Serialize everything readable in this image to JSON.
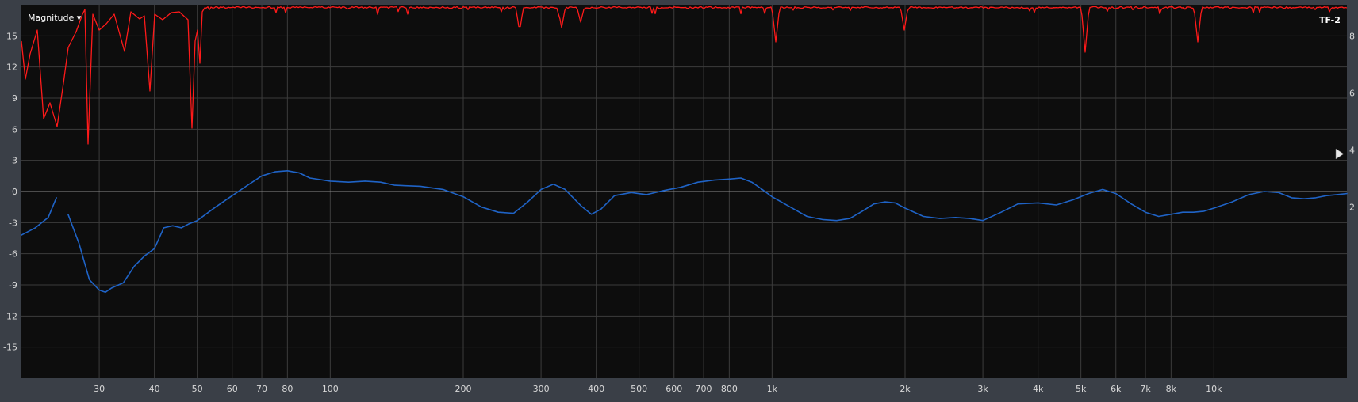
{
  "header": {
    "view_selector": "Magnitude ▾",
    "trace_label": "TF-2"
  },
  "colors": {
    "background": "#0d0d0d",
    "frame": "#3a3f47",
    "grid": "#3c3c3c",
    "zero_line": "#8a8a8a",
    "magnitude_trace": "#1f63c6",
    "coherence_trace": "#ff1a1a"
  },
  "icons": {
    "reference_marker": "triangle-marker-icon"
  },
  "chart_data": {
    "type": "line",
    "x_scale": "log",
    "xlim": [
      20,
      20000
    ],
    "ylim": [
      -18,
      18
    ],
    "grid": true,
    "y_ticks": [
      15,
      12,
      9,
      6,
      3,
      0,
      -3,
      -6,
      -9,
      -12,
      -15
    ],
    "y_tick_labels": [
      "15",
      "12",
      "9",
      "6",
      "3",
      "0",
      "-3",
      "-6",
      "-9",
      "-12",
      "-15"
    ],
    "right_ticks": [
      {
        "label": "8",
        "at": 15
      },
      {
        "label": "6",
        "at": 9.5
      },
      {
        "label": "4",
        "at": 4
      },
      {
        "label": "2",
        "at": -1.5
      }
    ],
    "x_ticks": [
      {
        "value": 30,
        "label": "30"
      },
      {
        "value": 40,
        "label": "40"
      },
      {
        "value": 50,
        "label": "50"
      },
      {
        "value": 60,
        "label": "60"
      },
      {
        "value": 70,
        "label": "70"
      },
      {
        "value": 80,
        "label": "80"
      },
      {
        "value": 100,
        "label": "100"
      },
      {
        "value": 200,
        "label": "200"
      },
      {
        "value": 300,
        "label": "300"
      },
      {
        "value": 400,
        "label": "400"
      },
      {
        "value": 500,
        "label": "500"
      },
      {
        "value": 600,
        "label": "600"
      },
      {
        "value": 700,
        "label": "700"
      },
      {
        "value": 800,
        "label": "800"
      },
      {
        "value": 1000,
        "label": "1k"
      },
      {
        "value": 2000,
        "label": "2k"
      },
      {
        "value": 3000,
        "label": "3k"
      },
      {
        "value": 4000,
        "label": "4k"
      },
      {
        "value": 5000,
        "label": "5k"
      },
      {
        "value": 6000,
        "label": "6k"
      },
      {
        "value": 7000,
        "label": "7k"
      },
      {
        "value": 8000,
        "label": "8k"
      },
      {
        "value": 10000,
        "label": "10k"
      }
    ],
    "series": [
      {
        "segments": [
          [
            [
              20,
              -4.2
            ],
            [
              21.5,
              -3.5
            ],
            [
              23,
              -2.5
            ],
            [
              24,
              -0.6
            ]
          ],
          [
            [
              25.5,
              -2.2
            ],
            [
              27,
              -5
            ],
            [
              28.5,
              -8.5
            ],
            [
              30,
              -9.5
            ],
            [
              31,
              -9.7
            ],
            [
              32,
              -9.3
            ],
            [
              34,
              -8.8
            ],
            [
              36,
              -7.2
            ],
            [
              38,
              -6.2
            ],
            [
              40,
              -5.5
            ],
            [
              42,
              -3.5
            ],
            [
              44,
              -3.3
            ],
            [
              46,
              -3.5
            ],
            [
              48,
              -3.1
            ],
            [
              50,
              -2.8
            ],
            [
              55,
              -1.5
            ],
            [
              60,
              -0.4
            ],
            [
              65,
              0.6
            ],
            [
              70,
              1.5
            ],
            [
              75,
              1.9
            ],
            [
              80,
              2.0
            ],
            [
              85,
              1.8
            ],
            [
              90,
              1.3
            ],
            [
              100,
              1.0
            ],
            [
              110,
              0.9
            ],
            [
              120,
              1.0
            ],
            [
              130,
              0.9
            ],
            [
              140,
              0.6
            ],
            [
              160,
              0.5
            ],
            [
              180,
              0.2
            ],
            [
              200,
              -0.5
            ],
            [
              220,
              -1.5
            ],
            [
              240,
              -2.0
            ],
            [
              260,
              -2.1
            ],
            [
              280,
              -1.0
            ],
            [
              300,
              0.2
            ],
            [
              320,
              0.7
            ],
            [
              340,
              0.2
            ],
            [
              370,
              -1.4
            ],
            [
              390,
              -2.2
            ],
            [
              410,
              -1.7
            ],
            [
              440,
              -0.4
            ],
            [
              480,
              -0.1
            ],
            [
              520,
              -0.3
            ],
            [
              570,
              0.1
            ],
            [
              620,
              0.4
            ],
            [
              680,
              0.9
            ],
            [
              740,
              1.1
            ],
            [
              800,
              1.2
            ],
            [
              850,
              1.3
            ],
            [
              900,
              0.9
            ],
            [
              950,
              0.2
            ],
            [
              1000,
              -0.5
            ],
            [
              1100,
              -1.5
            ],
            [
              1200,
              -2.4
            ],
            [
              1300,
              -2.7
            ],
            [
              1400,
              -2.8
            ],
            [
              1500,
              -2.6
            ],
            [
              1600,
              -1.9
            ],
            [
              1700,
              -1.2
            ],
            [
              1800,
              -1.0
            ],
            [
              1900,
              -1.1
            ],
            [
              2000,
              -1.6
            ],
            [
              2200,
              -2.4
            ],
            [
              2400,
              -2.6
            ],
            [
              2600,
              -2.5
            ],
            [
              2800,
              -2.6
            ],
            [
              3000,
              -2.8
            ],
            [
              3300,
              -2.0
            ],
            [
              3600,
              -1.2
            ],
            [
              4000,
              -1.1
            ],
            [
              4400,
              -1.3
            ],
            [
              4800,
              -0.8
            ],
            [
              5200,
              -0.2
            ],
            [
              5600,
              0.2
            ],
            [
              6000,
              -0.2
            ],
            [
              6500,
              -1.2
            ],
            [
              7000,
              -2.0
            ],
            [
              7500,
              -2.4
            ],
            [
              8000,
              -2.2
            ],
            [
              8500,
              -2.0
            ],
            [
              9000,
              -2.0
            ],
            [
              9500,
              -1.9
            ],
            [
              10000,
              -1.6
            ],
            [
              11000,
              -1.0
            ],
            [
              12000,
              -0.3
            ],
            [
              13000,
              0.0
            ],
            [
              14000,
              -0.1
            ],
            [
              15000,
              -0.6
            ],
            [
              16000,
              -0.7
            ],
            [
              17000,
              -0.6
            ],
            [
              18000,
              -0.4
            ],
            [
              19000,
              -0.3
            ],
            [
              20000,
              -0.2
            ]
          ]
        ]
      }
    ]
  }
}
